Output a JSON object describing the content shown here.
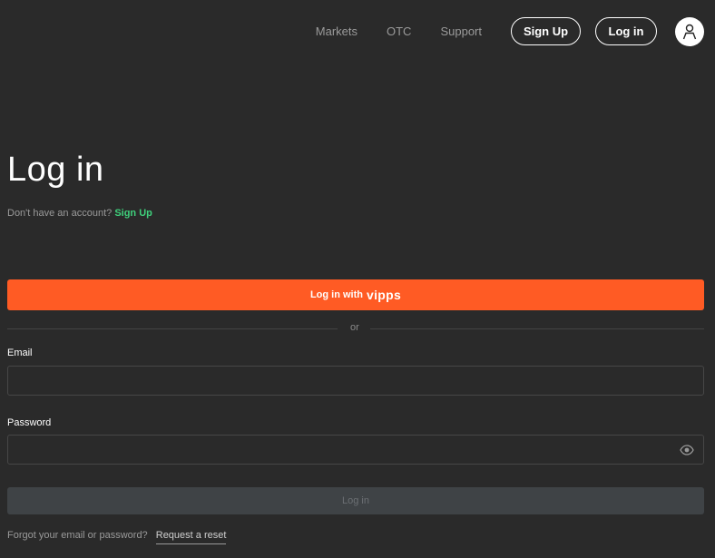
{
  "nav": {
    "markets": "Markets",
    "otc": "OTC",
    "support": "Support",
    "signup": "Sign Up",
    "login": "Log in"
  },
  "page": {
    "title": "Log in",
    "no_account": "Don't have an account?",
    "signup_link": "Sign Up"
  },
  "vipps": {
    "label": "Log in with",
    "brand": "vipps",
    "color": "#ff5b24"
  },
  "divider": {
    "text": "or"
  },
  "form": {
    "email_label": "Email",
    "email_value": "",
    "password_label": "Password",
    "password_value": "",
    "submit": "Log in",
    "forgot": "Forgot your email or password?",
    "reset": "Request a reset"
  },
  "colors": {
    "background": "#2a2a2a",
    "accent_green": "#3fd17c",
    "disabled_button": "#3f4346"
  }
}
